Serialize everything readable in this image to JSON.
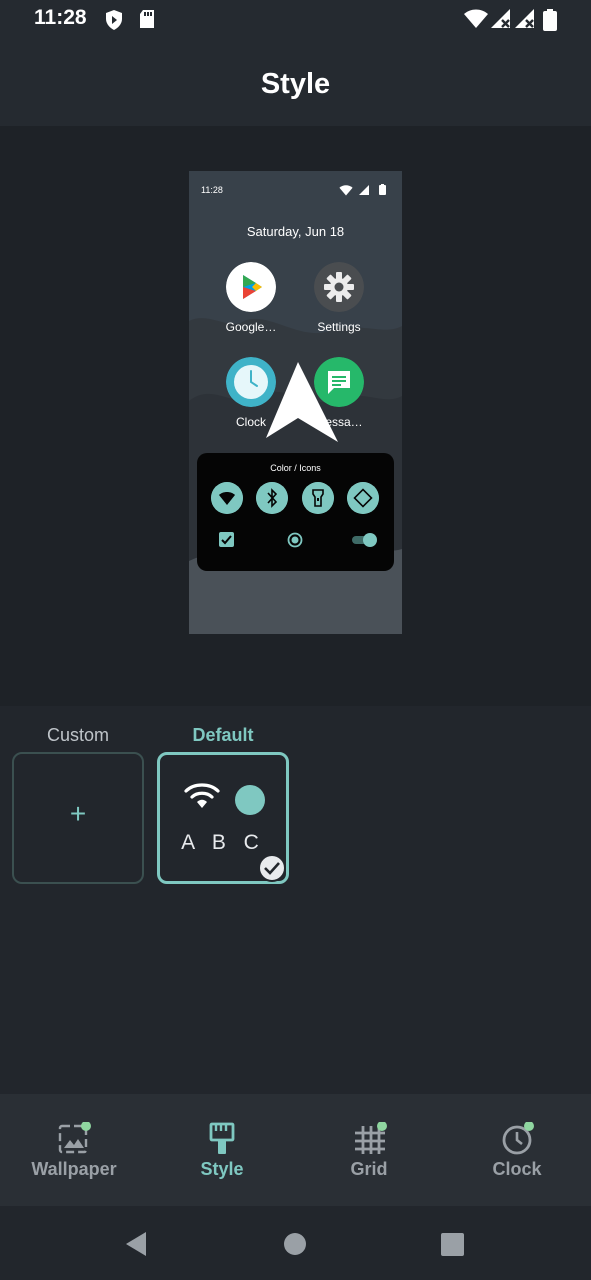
{
  "status_bar": {
    "time": "11:28",
    "left_icons": [
      "shield-icon",
      "sd-card-icon"
    ],
    "right_icons": [
      "wifi-icon",
      "signal-icon",
      "signal-icon",
      "battery-icon"
    ]
  },
  "header": {
    "title": "Style"
  },
  "preview": {
    "status_time": "11:28",
    "date": "Saturday, Jun 18",
    "apps": [
      {
        "label": "Google…",
        "icon": "google-play-icon"
      },
      {
        "label": "Settings",
        "icon": "settings-gear-icon"
      },
      {
        "label": "Clock",
        "icon": "clock-icon"
      },
      {
        "label": "Messa…",
        "icon": "messages-icon"
      }
    ],
    "panel_title": "Color / Icons",
    "quick_tiles": [
      "wifi-icon",
      "bluetooth-icon",
      "flashlight-icon",
      "auto-rotate-icon"
    ]
  },
  "options": {
    "custom_label": "Custom",
    "custom_plus": "+",
    "default_label": "Default",
    "default_preview_text": "A B C"
  },
  "bottom_nav": {
    "items": [
      {
        "label": "Wallpaper",
        "icon": "wallpaper-icon"
      },
      {
        "label": "Style",
        "icon": "brush-icon"
      },
      {
        "label": "Grid",
        "icon": "grid-icon"
      },
      {
        "label": "Clock",
        "icon": "clock-icon"
      }
    ],
    "active_index": 1
  },
  "colors": {
    "accent": "#7fc8c1",
    "background": "#22262c",
    "indicator_dot": "#8fd6a0"
  }
}
